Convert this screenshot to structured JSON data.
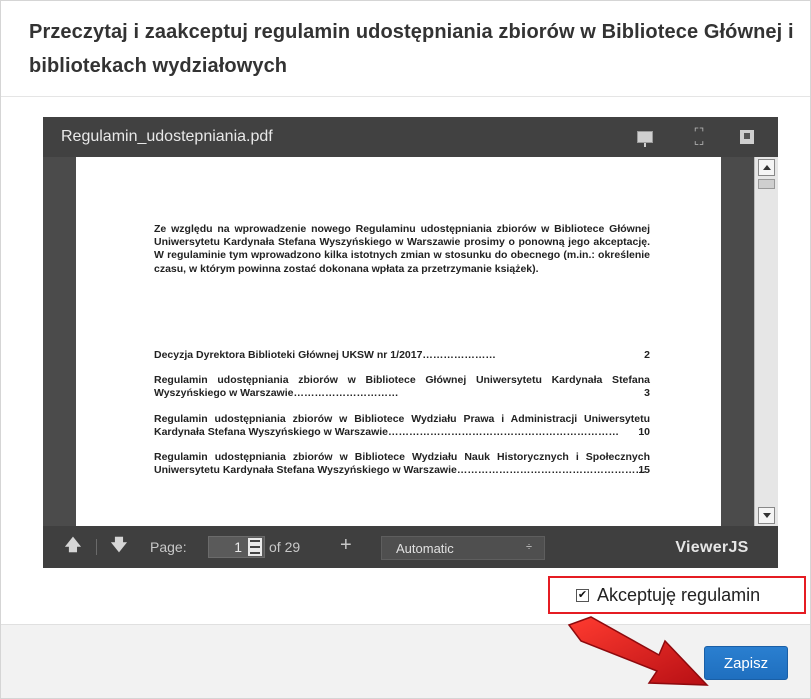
{
  "dialog": {
    "title": "Przeczytaj i zaakceptuj regulamin udostępniania zbiorów w Bibliotece Głównej i bibliotekach wydziałowych"
  },
  "viewer": {
    "document_name": "Regulamin_udostepniania.pdf",
    "icons": [
      "presentation-icon",
      "fullscreen-icon",
      "download-icon"
    ],
    "intro_text": "Ze względu na wprowadzenie nowego Regulaminu udostępniania zbiorów w Bibliotece Głównej Uniwersytetu Kardynała Stefana Wyszyńskiego w Warszawie prosimy o ponowną jego akceptację. W regulaminie tym wprowadzono kilka istotnych zmian w stosunku do obecnego (m.in.: określenie czasu, w którym powinna zostać dokonana wpłata za przetrzymanie książek).",
    "toc": [
      {
        "text": "Decyzja Dyrektora Biblioteki Głównej UKSW nr 1/2017",
        "dots": "…………………",
        "page": "2"
      },
      {
        "text": "Regulamin udostępniania zbiorów w Bibliotece Głównej Uniwersytetu Kardynała Stefana Wyszyńskiego w Warszawie",
        "dots": "…………………………",
        "page": "3"
      },
      {
        "text": "Regulamin udostępniania zbiorów w Bibliotece Wydziału Prawa i Administracji Uniwersytetu Kardynała Stefana Wyszyńskiego w Warszawie",
        "dots": "…………………………………………………………",
        "page": "10"
      },
      {
        "text": "Regulamin udostępniania zbiorów w Bibliotece Wydziału Nauk Historycznych i Społecznych Uniwersytetu Kardynała Stefana Wyszyńskiego w Warszawie",
        "dots": "………………………………………………",
        "page": "15"
      }
    ],
    "toolbar": {
      "page_label": "Page:",
      "current_page": "1",
      "page_of": "of 29",
      "zoom_in": "+",
      "zoom_value": "Automatic",
      "zoom_arrow": "÷",
      "brand": "ViewerJS",
      "prev_icon": "arrow-up-icon",
      "next_icon": "arrow-down-icon"
    }
  },
  "accept": {
    "checked": true,
    "label": "Akceptuję regulamin"
  },
  "footer": {
    "save_label": "Zapisz"
  },
  "colors": {
    "highlight_red": "#e51c23",
    "save_blue": "#1f6fbf"
  }
}
